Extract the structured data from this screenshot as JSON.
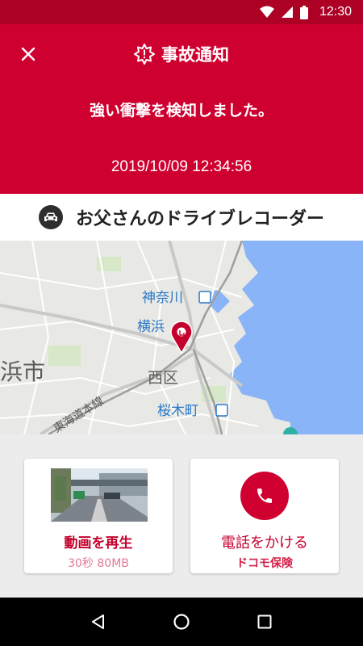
{
  "status_bar": {
    "time": "12:30",
    "icons": [
      "wifi-icon",
      "signal-icon",
      "battery-icon"
    ]
  },
  "header": {
    "close_icon": "close-icon",
    "title_icon": "alert-burst-icon",
    "title": "事故通知",
    "message": "強い衝撃を検知しました。",
    "datetime": "2019/10/09  12:34:56"
  },
  "device": {
    "icon": "car-icon",
    "name": "お父さんのドライブレコーダー"
  },
  "map": {
    "labels": {
      "kanagawa": "神奈川",
      "yokohama": "横浜",
      "nishiku": "西区",
      "sakuragicho": "桜木町",
      "tokaido": "東海道本線",
      "city_suffix": "浜市"
    },
    "pin_icon": "location-pin-icon"
  },
  "actions": {
    "video": {
      "label": "動画を再生",
      "sub": "30秒 80MB"
    },
    "call": {
      "icon": "phone-icon",
      "label": "電話をかける",
      "sub": "ドコモ保険"
    }
  },
  "nav": [
    "back-icon",
    "home-icon",
    "recents-icon"
  ],
  "colors": {
    "status_bar": "#ac0024",
    "header": "#ce0030",
    "accent": "#c4002c",
    "map_water": "#8ab4f8",
    "map_label": "#2a78c8"
  }
}
